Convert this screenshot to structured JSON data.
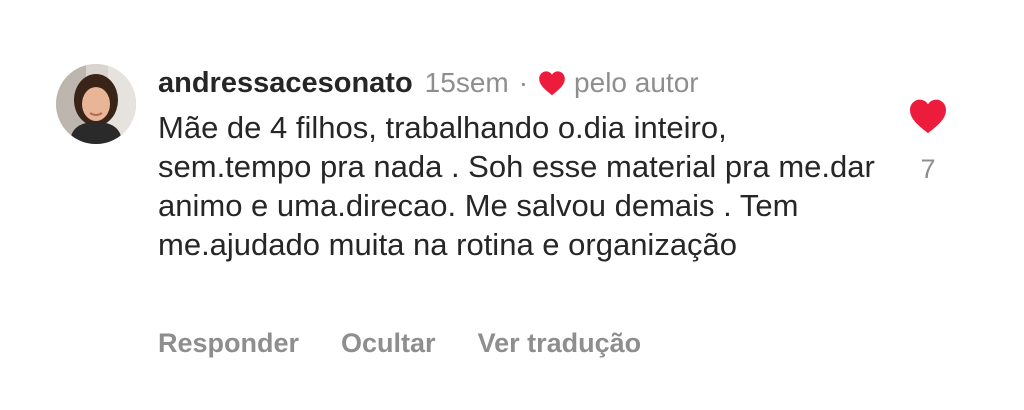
{
  "comment": {
    "username": "andressacesonato",
    "time": "15sem",
    "separator": "·",
    "liked_by_label": "pelo autor",
    "text": "Mãe de 4 filhos, trabalhando o.dia inteiro, sem.tempo pra nada . Soh esse material pra me.dar animo e uma.direcao. Me salvou demais . Tem me.ajudado muita na rotina e organização",
    "like_count": "7",
    "heart_color": "#ed1c3c"
  },
  "actions": {
    "reply_label": "Responder",
    "hide_label": "Ocultar",
    "translate_label": "Ver tradução"
  }
}
